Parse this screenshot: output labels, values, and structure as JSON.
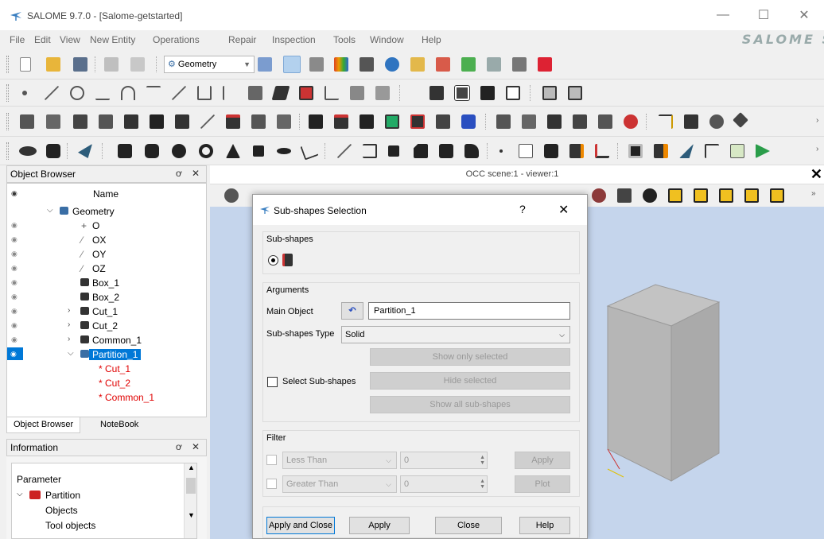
{
  "window": {
    "title": "SALOME  9.7.0 - [Salome-getstarted]",
    "brand": "SALOME S",
    "minimize": "—",
    "maximize": "☐",
    "close": "✕"
  },
  "menubar": [
    "File",
    "Edit",
    "View",
    "New Entity",
    "Operations",
    "Repair",
    "Inspection",
    "Tools",
    "Window",
    "Help"
  ],
  "toolbar": {
    "module_combo": "Geometry"
  },
  "object_browser": {
    "title": "Object Browser",
    "float": "ơ",
    "close": "✕",
    "column_name": "Name",
    "column_eye": "👁",
    "items": [
      {
        "label": "Geometry",
        "indent": 0,
        "expanded": true
      },
      {
        "label": "O"
      },
      {
        "label": "OX"
      },
      {
        "label": "OY"
      },
      {
        "label": "OZ"
      },
      {
        "label": "Box_1"
      },
      {
        "label": "Box_2"
      },
      {
        "label": "Cut_1"
      },
      {
        "label": "Cut_2"
      },
      {
        "label": "Common_1"
      },
      {
        "label": "Partition_1"
      },
      {
        "label": "* Cut_1"
      },
      {
        "label": "* Cut_2"
      },
      {
        "label": "* Common_1"
      }
    ],
    "tabs": [
      "Object Browser",
      "NoteBook"
    ]
  },
  "information": {
    "title": "Information",
    "rows": [
      "Parameter",
      "Partition",
      "Objects",
      "Tool objects"
    ]
  },
  "viewer": {
    "title": "OCC scene:1 - viewer:1",
    "close": "✕"
  },
  "dialog": {
    "title": "Sub-shapes Selection",
    "help_q": "?",
    "close": "✕",
    "subshapes_group": "Sub-shapes",
    "arguments_group": "Arguments",
    "main_object_label": "Main Object",
    "main_object_value": "Partition_1",
    "subshapes_type_label": "Sub-shapes Type",
    "subshapes_type_value": "Solid",
    "show_only_selected": "Show only selected",
    "select_subshapes": "Select Sub-shapes",
    "hide_selected": "Hide selected",
    "show_all": "Show all sub-shapes",
    "filter_group": "Filter",
    "less_than": "Less Than",
    "greater_than": "Greater Than",
    "less_value": "0",
    "greater_value": "0",
    "apply_filter": "Apply",
    "plot": "Plot",
    "apply_and_close": "Apply and Close",
    "apply": "Apply",
    "close_btn": "Close",
    "help": "Help"
  },
  "colors": {
    "selection": "#0078d7",
    "reference_text": "#e00000",
    "viewer_bg": "#c5d5ec"
  }
}
